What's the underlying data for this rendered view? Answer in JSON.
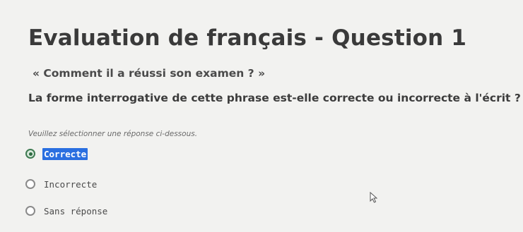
{
  "quiz": {
    "title": "Evaluation de français - Question 1",
    "quote": "« Comment il a réussi son examen ? »",
    "prompt": "La forme interrogative de cette phrase est-elle correcte ou incorrecte à l'écrit ?",
    "instruction": "Veuillez sélectionner une réponse ci-dessous.",
    "options": [
      {
        "label": "Correcte",
        "selected": true
      },
      {
        "label": "Incorrecte",
        "selected": false
      },
      {
        "label": "Sans réponse",
        "selected": false
      }
    ]
  },
  "icons": {
    "cursor": "mouse-pointer-icon"
  },
  "colors": {
    "selection_highlight": "#2a6fe0",
    "radio_checked": "#2f6b42"
  }
}
